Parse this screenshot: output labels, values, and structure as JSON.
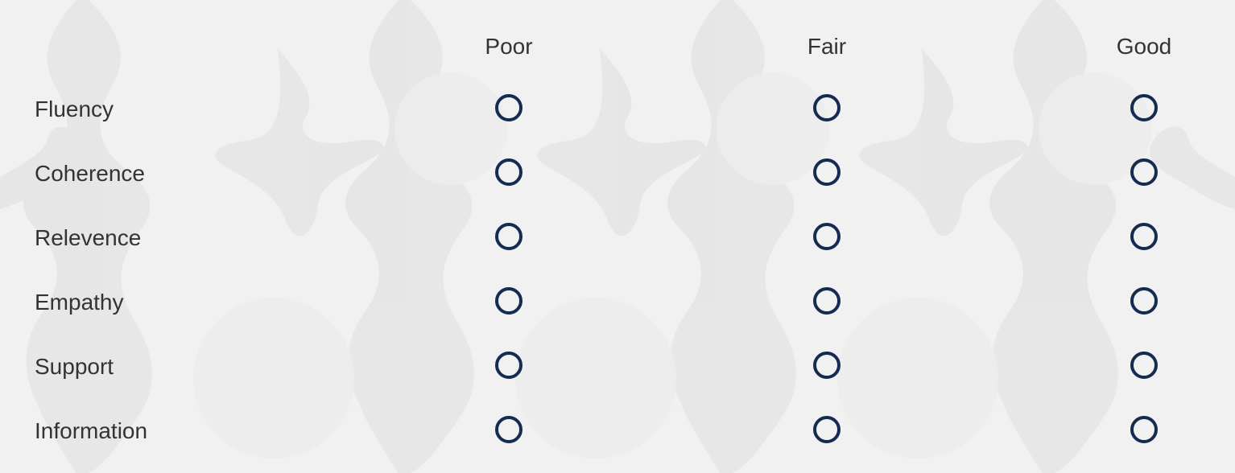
{
  "survey_matrix": {
    "columns": [
      {
        "key": "poor",
        "label": "Poor"
      },
      {
        "key": "fair",
        "label": "Fair"
      },
      {
        "key": "good",
        "label": "Good"
      }
    ],
    "rows": [
      {
        "key": "fluency",
        "label": "Fluency",
        "selected": null
      },
      {
        "key": "coherence",
        "label": "Coherence",
        "selected": null
      },
      {
        "key": "relevence",
        "label": "Relevence",
        "selected": null
      },
      {
        "key": "empathy",
        "label": "Empathy",
        "selected": null
      },
      {
        "key": "support",
        "label": "Support",
        "selected": null
      },
      {
        "key": "information",
        "label": "Information",
        "selected": null
      }
    ]
  },
  "colors": {
    "background": "#f1f1f1",
    "pattern": "#e6e6e6",
    "radio_border": "#162b52",
    "text": "#333333"
  },
  "icons": {
    "radio_unselected": "radio-unselected-icon"
  }
}
